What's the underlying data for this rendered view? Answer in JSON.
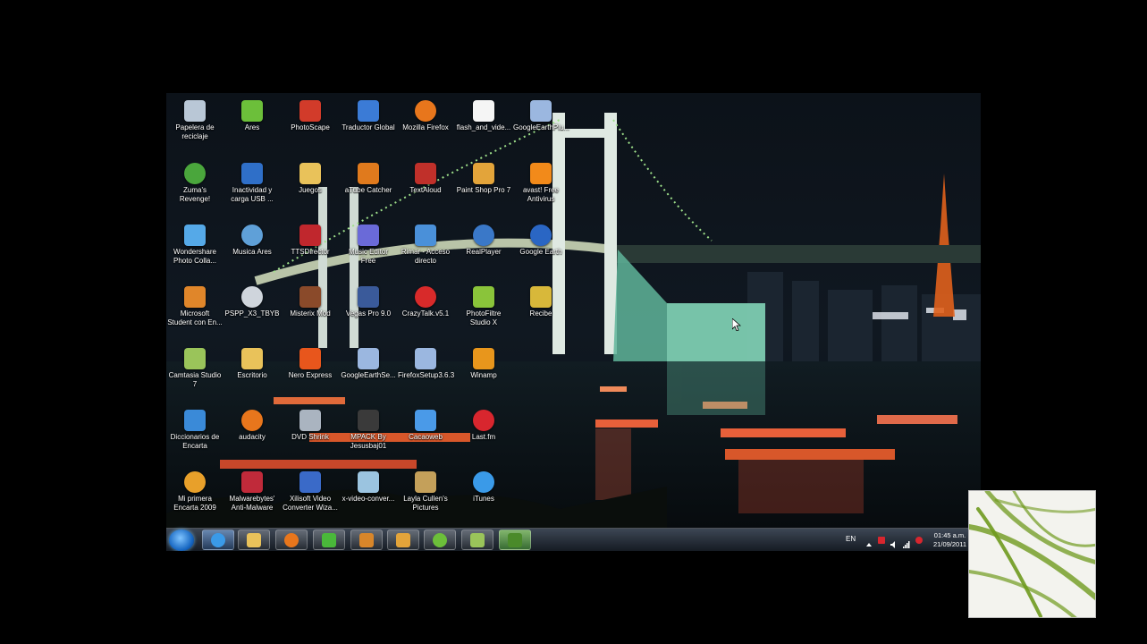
{
  "desktop": {
    "icons": [
      {
        "label": "Papelera de reciclaje",
        "icon": "recycle-bin-icon",
        "color": "#b9c7d6"
      },
      {
        "label": "Ares",
        "icon": "ares-icon",
        "color": "#6cbf3a"
      },
      {
        "label": "PhotoScape",
        "icon": "photoscape-icon",
        "color": "#d23b2a"
      },
      {
        "label": "Traductor Global",
        "icon": "translator-icon",
        "color": "#3b7bd6"
      },
      {
        "label": "Mozilla Firefox",
        "icon": "firefox-icon",
        "color": "#e8761c"
      },
      {
        "label": "flash_and_vide...",
        "icon": "file-icon",
        "color": "#f5f5f5"
      },
      {
        "label": "GoogleEarthPlu...",
        "icon": "installer-icon",
        "color": "#9bb7e0"
      },
      {
        "label": "Zuma's Revenge!",
        "icon": "zuma-icon",
        "color": "#4aa63c"
      },
      {
        "label": "Inactividad y carga USB ...",
        "icon": "usb-icon",
        "color": "#2f6fc8"
      },
      {
        "label": "Juegos",
        "icon": "folder-icon",
        "color": "#e9c25a"
      },
      {
        "label": "aTube Catcher",
        "icon": "atube-icon",
        "color": "#e07a1d"
      },
      {
        "label": "TextAloud",
        "icon": "textaloud-icon",
        "color": "#c0302a"
      },
      {
        "label": "Paint Shop Pro 7",
        "icon": "paintshop-icon",
        "color": "#e3a43a"
      },
      {
        "label": "avast! Free Antivirus",
        "icon": "avast-icon",
        "color": "#f28a1a"
      },
      {
        "label": "Wondershare Photo Colla...",
        "icon": "wondershare-icon",
        "color": "#55a9e8"
      },
      {
        "label": "Musica Ares",
        "icon": "music-icon",
        "color": "#5fa0d8"
      },
      {
        "label": "TTSDirector",
        "icon": "tts-icon",
        "color": "#c0272d"
      },
      {
        "label": "Music Editor Free",
        "icon": "music-editor-icon",
        "color": "#6a6ad8"
      },
      {
        "label": "Rimar - Acceso directo",
        "icon": "shortcut-icon",
        "color": "#4a90d9"
      },
      {
        "label": "RealPlayer",
        "icon": "realplayer-icon",
        "color": "#3a78c8"
      },
      {
        "label": "Google Earth",
        "icon": "google-earth-icon",
        "color": "#2a66c4"
      },
      {
        "label": "Microsoft Student con En...",
        "icon": "student-icon",
        "color": "#e0862a"
      },
      {
        "label": "PSPP_X3_TBYB",
        "icon": "cd-icon",
        "color": "#cfd5dc"
      },
      {
        "label": "Misterix Mod",
        "icon": "misterix-icon",
        "color": "#8a4a2a"
      },
      {
        "label": "Vegas Pro 9.0",
        "icon": "vegas-icon",
        "color": "#3a5a9a"
      },
      {
        "label": "CrazyTalk.v5.1",
        "icon": "crazytalk-icon",
        "color": "#d82a2a"
      },
      {
        "label": "PhotoFiltre Studio X",
        "icon": "photofiltre-icon",
        "color": "#8ac43a"
      },
      {
        "label": "Recibe",
        "icon": "receive-icon",
        "color": "#d8b83a"
      },
      {
        "label": "Camtasia Studio 7",
        "icon": "camtasia-icon",
        "color": "#9ac45a"
      },
      {
        "label": "Escritorio",
        "icon": "folder-icon",
        "color": "#e9c25a"
      },
      {
        "label": "Nero Express",
        "icon": "nero-icon",
        "color": "#e8561c"
      },
      {
        "label": "GoogleEarthSe...",
        "icon": "installer-icon",
        "color": "#9bb7e0"
      },
      {
        "label": "FirefoxSetup3.6.3",
        "icon": "installer-icon",
        "color": "#9bb7e0"
      },
      {
        "label": "Winamp",
        "icon": "winamp-icon",
        "color": "#e8961c"
      },
      {
        "label": "Diccionarios de Encarta",
        "icon": "dictionary-icon",
        "color": "#3a8ad8"
      },
      {
        "label": "audacity",
        "icon": "audacity-icon",
        "color": "#e8761c"
      },
      {
        "label": "DVD Shrink",
        "icon": "dvd-icon",
        "color": "#aab4c0"
      },
      {
        "label": "MPACK By Jesusbaj01",
        "icon": "mpack-icon",
        "color": "#3a3a3a"
      },
      {
        "label": "Cacaoweb",
        "icon": "cacaoweb-icon",
        "color": "#4a9ae8"
      },
      {
        "label": "Last.fm",
        "icon": "lastfm-icon",
        "color": "#d8262e"
      },
      {
        "label": "Mi primera Encarta 2009",
        "icon": "encarta-icon",
        "color": "#e8a02a"
      },
      {
        "label": "Malwarebytes' Anti-Malware",
        "icon": "malwarebytes-icon",
        "color": "#c02a3a"
      },
      {
        "label": "Xilisoft Video Converter Wiza...",
        "icon": "xilisoft-icon",
        "color": "#3a6ac8"
      },
      {
        "label": "x-video-conver...",
        "icon": "installer-icon",
        "color": "#9bc4e0"
      },
      {
        "label": "Layla Cullen's Pictures",
        "icon": "folder-pictures-icon",
        "color": "#c4a05a"
      },
      {
        "label": "iTunes",
        "icon": "itunes-icon",
        "color": "#3a9ae8"
      }
    ]
  },
  "taskbar": {
    "pinned": [
      {
        "name": "internet-explorer-icon",
        "color": "#3a9ae8"
      },
      {
        "name": "windows-explorer-icon",
        "color": "#e9c25a"
      },
      {
        "name": "media-player-icon",
        "color": "#e8761c"
      },
      {
        "name": "messenger-icon",
        "color": "#4ab83a"
      },
      {
        "name": "package-icon",
        "color": "#d8862a"
      },
      {
        "name": "paint-shop-icon",
        "color": "#e3a43a"
      },
      {
        "name": "ares-icon",
        "color": "#6cbf3a"
      },
      {
        "name": "camtasia-icon",
        "color": "#9ac45a"
      },
      {
        "name": "camtasia-recorder-icon",
        "color": "#4a8a2a"
      }
    ],
    "language": "EN",
    "time": "01:45 a.m.",
    "date": "21/09/2011"
  }
}
